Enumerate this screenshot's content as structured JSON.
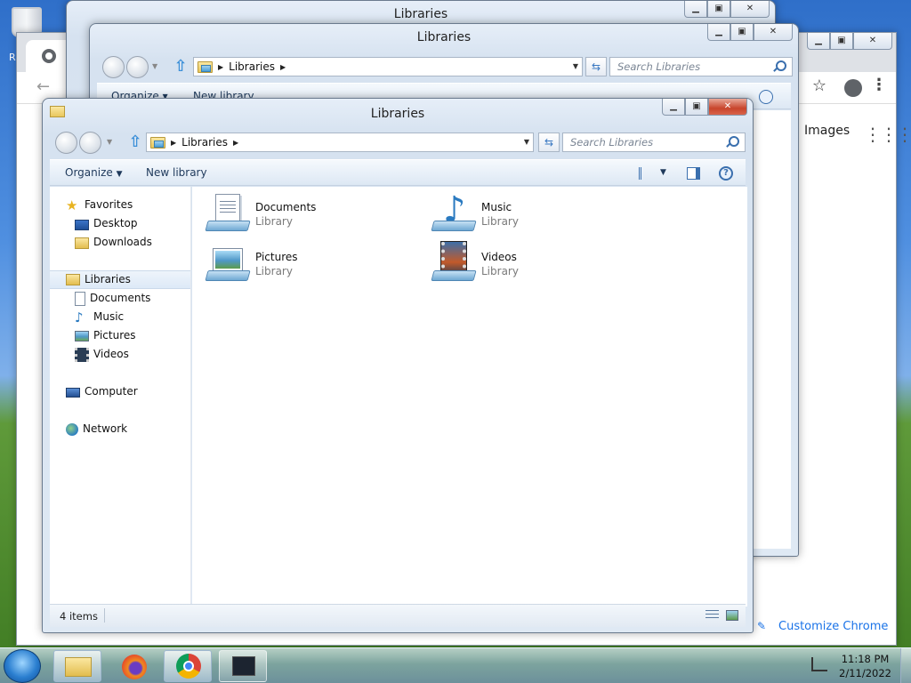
{
  "desktop": {
    "recycle_label": "R"
  },
  "chrome": {
    "images_link": "Images",
    "customize_label": "Customize Chrome"
  },
  "back_window_2": {
    "title": "Libraries"
  },
  "back_window_1": {
    "title": "Libraries",
    "breadcrumb": "Libraries",
    "search_placeholder": "Search Libraries",
    "organize_label": "Organize ▾",
    "new_library_label": "New library"
  },
  "main_window": {
    "title": "Libraries",
    "breadcrumb": "Libraries",
    "search_placeholder": "Search Libraries",
    "organize_label": "Organize",
    "new_library_label": "New library",
    "nav": {
      "favorites": "Favorites",
      "desktop": "Desktop",
      "downloads": "Downloads",
      "libraries": "Libraries",
      "documents": "Documents",
      "music": "Music",
      "pictures": "Pictures",
      "videos": "Videos",
      "computer": "Computer",
      "network": "Network"
    },
    "items": [
      {
        "name": "Documents",
        "type": "Library",
        "icon": "documents-library-icon"
      },
      {
        "name": "Music",
        "type": "Library",
        "icon": "music-library-icon"
      },
      {
        "name": "Pictures",
        "type": "Library",
        "icon": "pictures-library-icon"
      },
      {
        "name": "Videos",
        "type": "Library",
        "icon": "videos-library-icon"
      }
    ],
    "status": "4 items"
  },
  "taskbar": {
    "time": "11:18 PM",
    "date": "2/11/2022"
  },
  "colors": {
    "accent": "#3a78c2",
    "close_red": "#c8452c",
    "chrome_link": "#1a73e8"
  }
}
